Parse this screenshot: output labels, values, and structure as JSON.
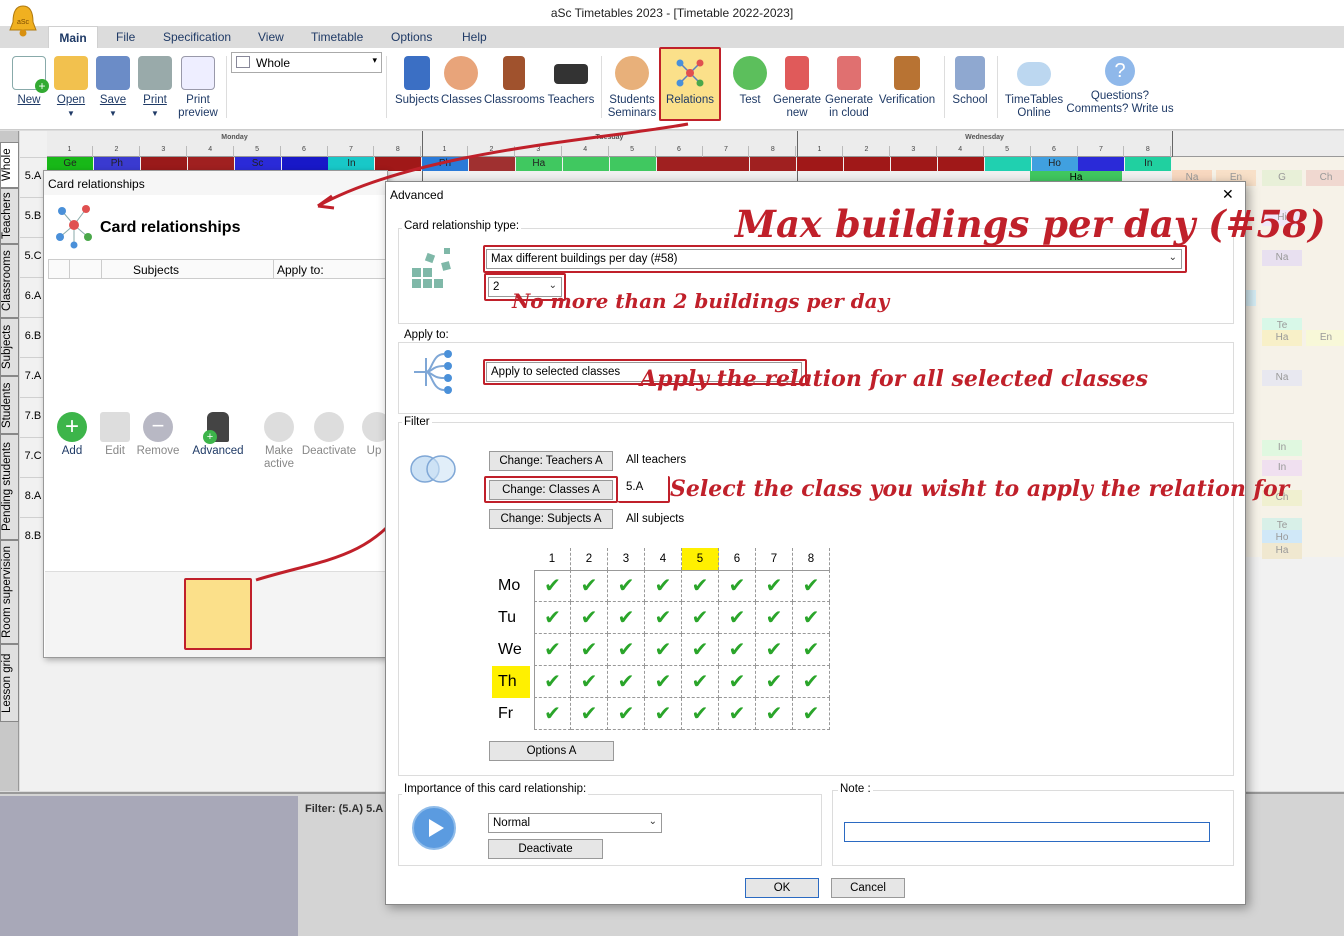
{
  "app": {
    "title": "aSc Timetables 2023  - [Timetable 2022-2023]",
    "logo_label": "aSc"
  },
  "menu": [
    "Main",
    "File",
    "Specification",
    "View",
    "Timetable",
    "Options",
    "Help"
  ],
  "ribbon": {
    "file_buttons": [
      "New",
      "Open",
      "Save",
      "Print",
      "Print\npreview"
    ],
    "view_select": "Whole",
    "buttons": [
      "Subjects",
      "Classes",
      "Classrooms",
      "Teachers",
      "Students\nSeminars",
      "Relations",
      "Test",
      "Generate\nnew",
      "Generate\nin cloud",
      "Verification",
      "School",
      "TimeTables\nOnline",
      "Questions?\nComments? Write us"
    ]
  },
  "vtabs": [
    "Whole",
    "Teachers",
    "Classrooms",
    "Subjects",
    "Students",
    "Pending students",
    "Room supervision",
    "Lesson grid"
  ],
  "timetable": {
    "days": [
      "Monday",
      "Tuesday",
      "Wednesday"
    ],
    "periods": [
      "1",
      "2",
      "3",
      "4",
      "5",
      "6",
      "7",
      "8"
    ],
    "rows": [
      "5.A",
      "5.B",
      "5.C",
      "6.A",
      "6.B",
      "7.A",
      "7.B",
      "7.C",
      "8.A",
      "8.B"
    ],
    "mon_5a_cells": [
      "Ge",
      "Ph",
      "",
      "",
      "Sc",
      "",
      "In",
      ""
    ],
    "tue_5a_cells": [
      "Ph",
      "",
      "Ha",
      "",
      "",
      "",
      "",
      ""
    ],
    "wed_5a_cells": [
      "",
      "",
      "",
      "",
      "",
      "Ho",
      "",
      "In"
    ],
    "wed_5a_second": "Ha",
    "right_cells": [
      "Na",
      "En",
      "G",
      "Hi",
      "Na",
      "Pa",
      "Te",
      "Ha",
      "Na",
      "In",
      "In",
      "Ch",
      "Te",
      "Ho",
      "Ha",
      "En",
      "Ch"
    ]
  },
  "filter_text": "Filter: (5.A) 5.A",
  "card_relationships": {
    "window_title": "Card relationships",
    "heading": "Card relationships",
    "columns": [
      "",
      "",
      "Subjects",
      "Apply to:"
    ],
    "tools": [
      "Add",
      "Edit",
      "Remove",
      "Advanced",
      "Make\nactive",
      "Deactivate",
      "Up"
    ]
  },
  "advanced": {
    "title": "Advanced",
    "type_group_label": "Card relationship type:",
    "type_value": "Max different buildings per day (#58)",
    "count_value": "2",
    "apply_group_label": "Apply to:",
    "apply_value": "Apply to selected classes",
    "filter_label": "Filter",
    "change_teachers": "Change: Teachers A",
    "teachers_value": "All teachers",
    "change_classes": "Change: Classes A",
    "classes_value": "5.A",
    "change_subjects": "Change: Subjects A",
    "subjects_value": "All subjects",
    "grid_periods": [
      "1",
      "2",
      "3",
      "4",
      "5",
      "6",
      "7",
      "8"
    ],
    "grid_days": [
      "Mo",
      "Tu",
      "We",
      "Th",
      "Fr"
    ],
    "check_mark": "✔",
    "options_button": "Options A",
    "importance_label": "Importance of this card relationship:",
    "importance_value": "Normal",
    "deactivate_button": "Deactivate",
    "note_label": "Note :",
    "ok_button": "OK",
    "cancel_button": "Cancel",
    "close_glyph": "✕"
  },
  "annotations": {
    "title_anno": "Max buildings per day (#58)",
    "count_anno": "No more than 2 buildings per day",
    "apply_anno": "Apply the relation for all selected classes",
    "class_anno": "Select the class you wisht to apply the relation for"
  },
  "colors": {
    "accent_red": "#c0202a",
    "highlight_yellow": "#fff000",
    "check_green": "#2aa52a",
    "menu_blue": "#1f3a66"
  }
}
